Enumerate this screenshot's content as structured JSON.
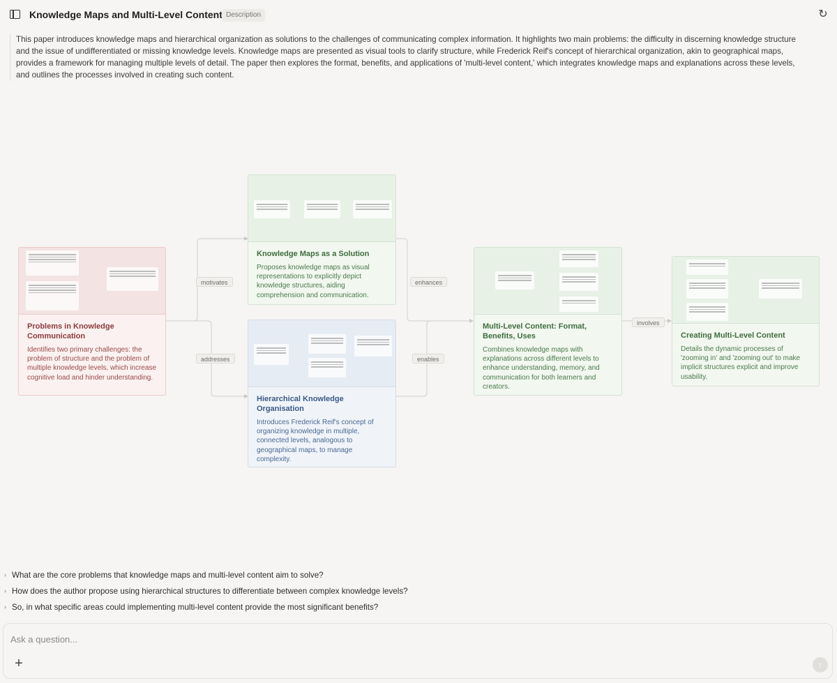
{
  "header": {
    "title": "Knowledge Maps and Multi-Level Content",
    "badge": "Description"
  },
  "description": "This paper introduces knowledge maps and hierarchical organization as solutions to the challenges of communicating complex information. It highlights two main problems: the difficulty in discerning knowledge structure and the issue of undifferentiated or missing knowledge levels. Knowledge maps are presented as visual tools to clarify structure, while Frederick Reif's concept of hierarchical organization, akin to geographical maps, provides a framework for managing multiple levels of detail. The paper then explores the format, benefits, and applications of 'multi-level content,' which integrates knowledge maps and explanations across these levels, and outlines the processes involved in creating such content.",
  "nodes": {
    "problems": {
      "title": "Problems in Knowledge Communication",
      "text": "Identifies two primary challenges: the problem of structure and the problem of multiple knowledge levels, which increase cognitive load and hinder understanding."
    },
    "maps": {
      "title": "Knowledge Maps as a Solution",
      "text": "Proposes knowledge maps as visual representations to explicitly depict knowledge structures, aiding comprehension and communication."
    },
    "hierarchy": {
      "title": "Hierarchical Knowledge Organisation",
      "text": "Introduces Frederick Reif's concept of organizing knowledge in multiple, connected levels, analogous to geographical maps, to manage complexity."
    },
    "multilevel": {
      "title": "Multi-Level Content: Format, Benefits, Uses",
      "text": "Combines knowledge maps with explanations across different levels to enhance understanding, memory, and communication for both learners and creators."
    },
    "creating": {
      "title": "Creating Multi-Level Content",
      "text": "Details the dynamic processes of 'zooming in' and 'zooming out' to make implicit structures explicit and improve usability."
    }
  },
  "edges": {
    "motivates": "motivates",
    "addresses": "addresses",
    "enhances": "enhances",
    "enables": "enables",
    "involves": "involves"
  },
  "questions": [
    "What are the core problems that knowledge maps and multi-level content aim to solve?",
    "How does the author propose using hierarchical structures to differentiate between complex knowledge levels?",
    "So, in what specific areas could implementing multi-level content provide the most significant benefits?"
  ],
  "ask": {
    "placeholder": "Ask a question..."
  },
  "icons": {
    "sidebar": "sidebar-toggle-icon",
    "refresh": "refresh-icon",
    "plus": "plus-icon",
    "send": "arrow-up-icon",
    "chevron": "chevron-right-icon"
  }
}
